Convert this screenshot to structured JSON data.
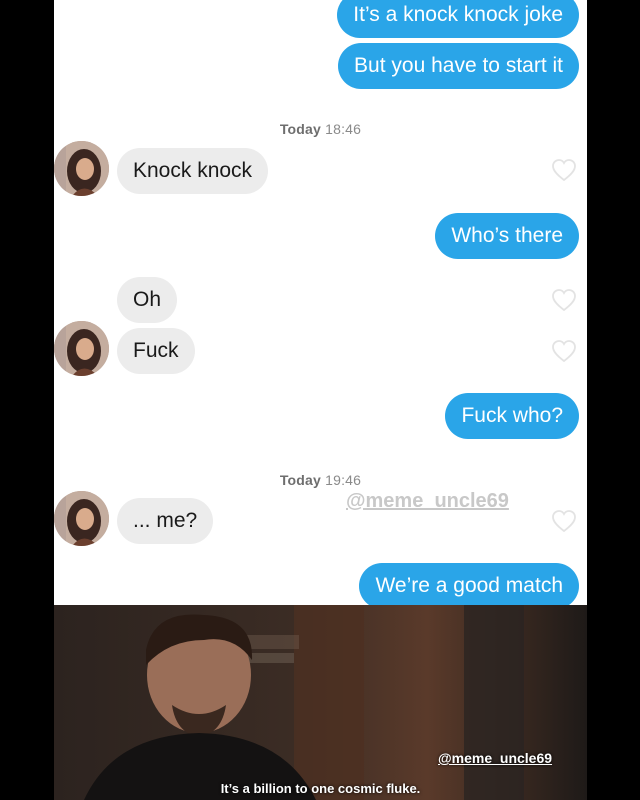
{
  "messages": {
    "m1": "It’s a knock knock joke",
    "m2": "But you have to start it",
    "m3": "Knock knock",
    "m4": "Who’s there",
    "m5": "Oh",
    "m6": "Fuck",
    "m7": "Fuck who?",
    "m8": "... me?",
    "m9": "We’re a good match"
  },
  "timestamps": [
    {
      "day": "Today",
      "time": "18:46"
    },
    {
      "day": "Today",
      "time": "19:46"
    }
  ],
  "watermark": "@meme_uncle69",
  "movie": {
    "subtitle": "It’s a billion to one cosmic fluke.",
    "watermark": "@meme_uncle69"
  },
  "colors": {
    "outgoing_bubble": "#2aa5e8",
    "incoming_bubble": "#ececec",
    "background": "#000000"
  },
  "icons": [
    "heart-outline-icon",
    "avatar-photo"
  ]
}
